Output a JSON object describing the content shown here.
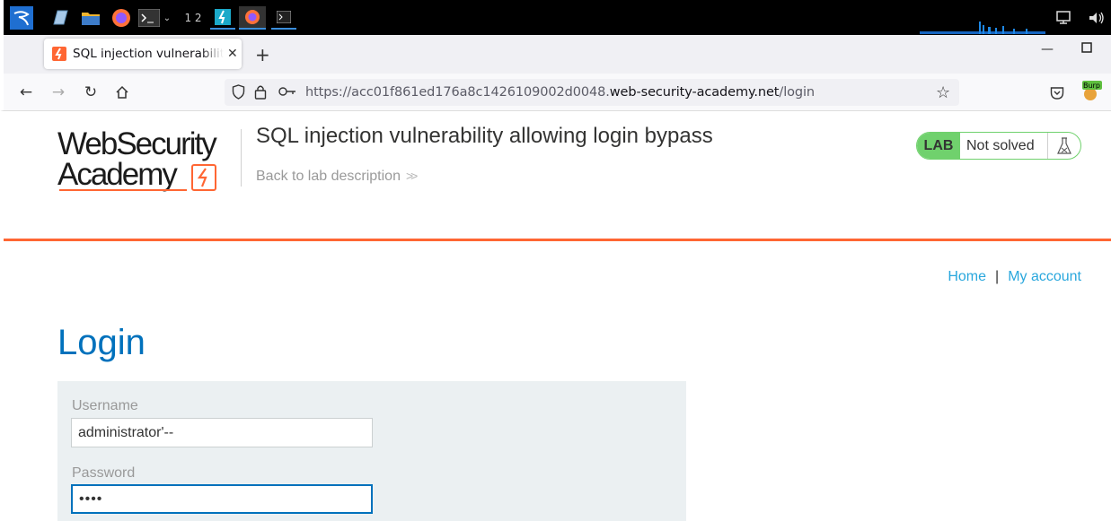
{
  "taskbar": {
    "workspaces": "1 2",
    "icons": [
      "kali-menu-icon",
      "files-icon",
      "folder-icon",
      "firefox-icon",
      "terminal-icon",
      "burp-icon",
      "firefox-window-icon",
      "terminal-window-icon",
      "network-icon",
      "volume-icon"
    ]
  },
  "browser": {
    "tab_title": "SQL injection vulnerability allowing login bypass",
    "new_tab": "+",
    "url_prefix": "https://acc01f861ed176a8c1426109002d0048.",
    "url_domain": "web-security-academy.net",
    "url_path": "/login",
    "extension_badge": "Burp"
  },
  "header": {
    "logo_line1": "WebSecurity",
    "logo_line2": "Academy",
    "lab_title": "SQL injection vulnerability allowing login bypass",
    "back_link": "Back to lab description",
    "lab_label": "LAB",
    "lab_status": "Not solved"
  },
  "nav": {
    "home": "Home",
    "separator": "|",
    "my_account": "My account"
  },
  "login": {
    "heading": "Login",
    "username_label": "Username",
    "username_value": "administrator'--",
    "password_label": "Password",
    "password_value": "••••"
  },
  "colors": {
    "accent_orange": "#ff6633",
    "link_blue": "#29a7dd",
    "heading_blue": "#0071bc",
    "lab_green": "#70d16d"
  }
}
